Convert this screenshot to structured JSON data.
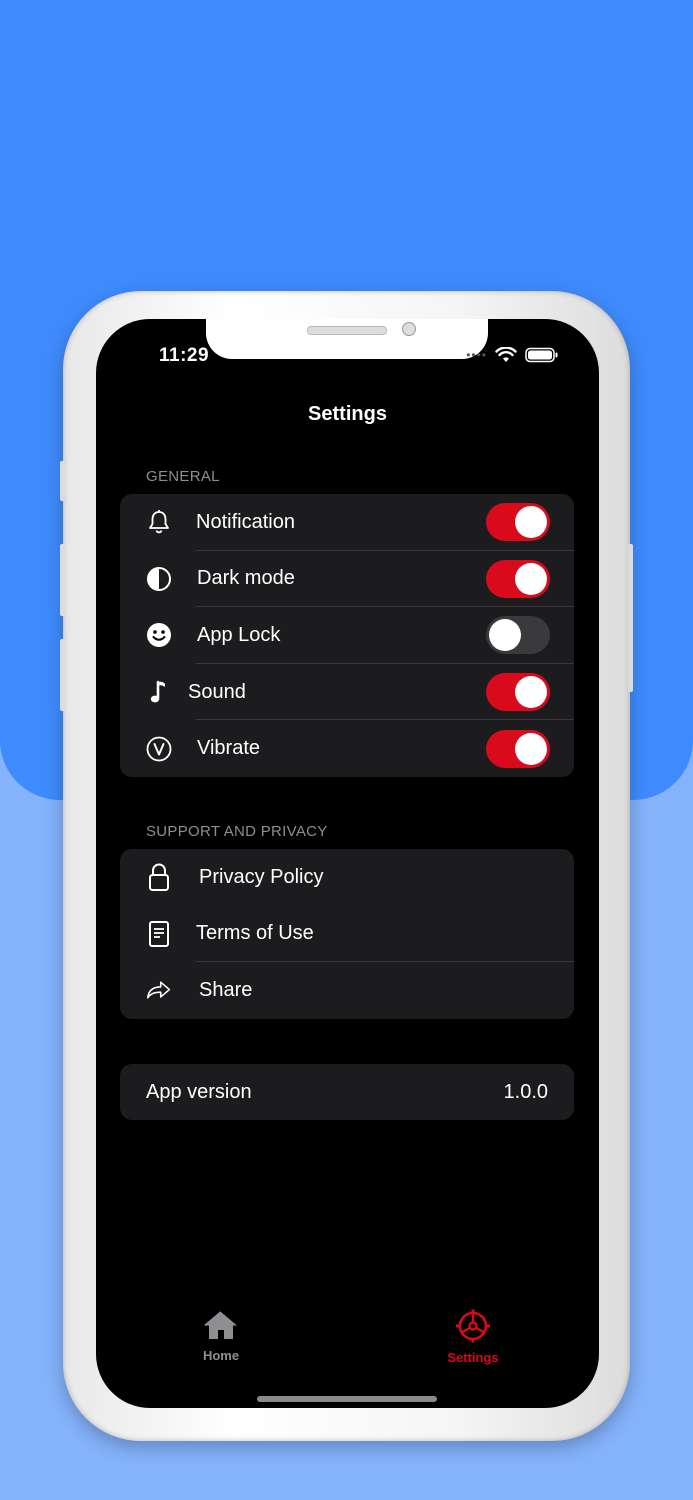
{
  "status_bar": {
    "time": "11:29"
  },
  "header": {
    "title": "Settings"
  },
  "general": {
    "section_label": "GENERAL",
    "items": [
      {
        "label": "Notification",
        "icon": "bell-icon",
        "on": true
      },
      {
        "label": "Dark mode",
        "icon": "contrast-icon",
        "on": true
      },
      {
        "label": "App Lock",
        "icon": "smiley-icon",
        "on": false
      },
      {
        "label": "Sound",
        "icon": "music-note-icon",
        "on": true
      },
      {
        "label": "Vibrate",
        "icon": "vibrate-icon",
        "on": true
      }
    ]
  },
  "support": {
    "section_label": "SUPPORT AND PRIVACY",
    "items": [
      {
        "label": "Privacy Policy",
        "icon": "lock-icon"
      },
      {
        "label": "Terms of Use",
        "icon": "document-icon"
      },
      {
        "label": "Share",
        "icon": "share-icon"
      }
    ]
  },
  "about": {
    "version_label": "App version",
    "version_value": "1.0.0"
  },
  "tabbar": {
    "home_label": "Home",
    "settings_label": "Settings",
    "active_color": "#d80a1c",
    "inactive_color": "#8e8e93"
  },
  "colors": {
    "accent": "#d80a1c",
    "background_top": "#3f8bfd",
    "background_bottom": "#84b2fb"
  }
}
